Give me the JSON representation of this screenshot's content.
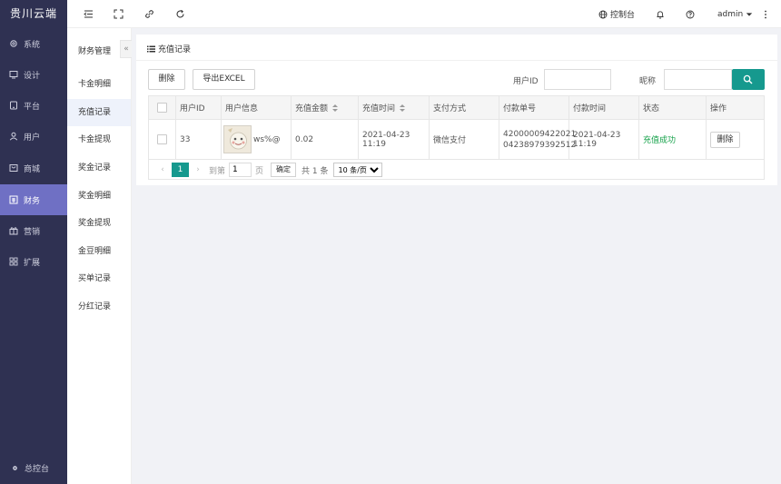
{
  "app": {
    "brand": "贵川云端"
  },
  "sidebar": {
    "items": [
      {
        "label": "系统",
        "icon": "gear-icon"
      },
      {
        "label": "设计",
        "icon": "monitor-icon"
      },
      {
        "label": "平台",
        "icon": "tablet-icon"
      },
      {
        "label": "用户",
        "icon": "user-icon"
      },
      {
        "label": "商城",
        "icon": "store-icon"
      },
      {
        "label": "财务",
        "icon": "finance-icon",
        "active": true
      },
      {
        "label": "营销",
        "icon": "gift-icon"
      },
      {
        "label": "扩展",
        "icon": "grid-icon"
      }
    ],
    "console_label": "总控台"
  },
  "subnav": {
    "title": "财务管理",
    "collapse_glyph": "«",
    "items": [
      {
        "label": "卡金明细"
      },
      {
        "label": "充值记录",
        "active": true
      },
      {
        "label": "卡金提现"
      },
      {
        "label": "奖金记录"
      },
      {
        "label": "奖金明细"
      },
      {
        "label": "奖金提现"
      },
      {
        "label": "金豆明细"
      },
      {
        "label": "买单记录"
      },
      {
        "label": "分红记录"
      }
    ]
  },
  "header": {
    "control_panel": "控制台",
    "username": "admin"
  },
  "page": {
    "title": "充值记录",
    "toolbar": {
      "delete_label": "删除",
      "export_label": "导出EXCEL"
    },
    "filters": {
      "user_id_label": "用户ID",
      "user_id_value": "",
      "nickname_label": "昵称",
      "nickname_value": ""
    },
    "accent_color": "#16998e"
  },
  "table": {
    "columns": [
      "用户ID",
      "用户信息",
      "充值金额",
      "充值时间",
      "支付方式",
      "付款单号",
      "付款时间",
      "状态",
      "操作"
    ],
    "rows": [
      {
        "user_id": "33",
        "nickname": "ws%@",
        "amount": "0.02",
        "recharge_time": "2021-04-23 11:19",
        "pay_method": "微信支付",
        "order_no_line1": "42000009422021",
        "order_no_line2": "04238979392512",
        "pay_time": "2021-04-23 11:19",
        "status": "充值成功",
        "action": "删除"
      }
    ]
  },
  "pagination": {
    "prev": "‹",
    "current_page": "1",
    "next": "›",
    "goto_label": "到第",
    "goto_value": "1",
    "page_unit": "页",
    "confirm_label": "确定",
    "total_label": "共 1 条",
    "page_size": "10 条/页"
  }
}
